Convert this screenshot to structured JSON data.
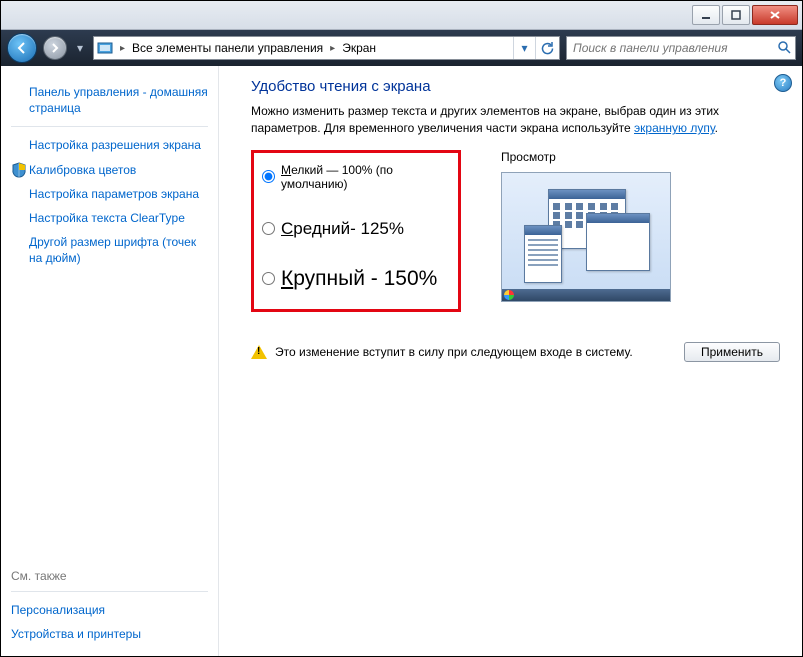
{
  "titlebar": {},
  "nav": {
    "address_segments": [
      "Все элементы панели управления",
      "Экран"
    ],
    "search_placeholder": "Поиск в панели управления"
  },
  "sidebar": {
    "home": "Панель управления - домашняя страница",
    "links": [
      "Настройка разрешения экрана",
      "Калибровка цветов",
      "Настройка параметров экрана",
      "Настройка текста ClearType",
      "Другой размер шрифта (точек на дюйм)"
    ],
    "see_also_label": "См. также",
    "see_also_links": [
      "Персонализация",
      "Устройства и принтеры"
    ]
  },
  "content": {
    "title": "Удобство чтения с экрана",
    "desc_1": "Можно изменить размер текста и других элементов на экране, выбрав один из этих параметров. Для временного увеличения части экрана используйте ",
    "desc_link": "экранную лупу",
    "desc_2": ".",
    "options": [
      {
        "label": "Мелкий — 100% (по умолчанию)",
        "checked": true
      },
      {
        "label": "Средний- 125%",
        "checked": false
      },
      {
        "label": "Крупный - 150%",
        "checked": false
      }
    ],
    "preview_label": "Просмотр",
    "warning": "Это изменение вступит в силу при следующем входе в систему.",
    "apply": "Применить"
  }
}
